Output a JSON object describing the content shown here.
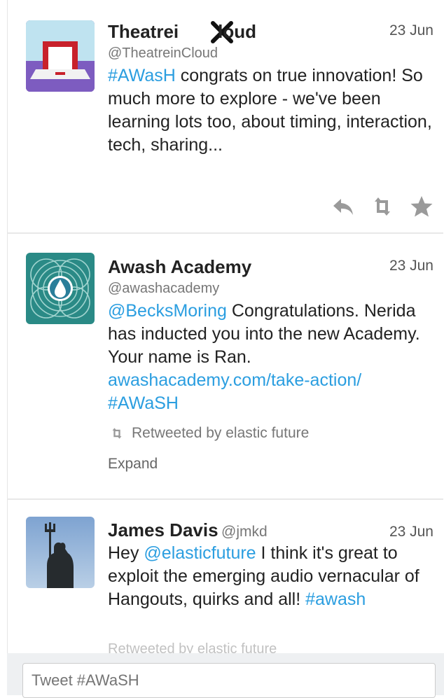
{
  "tweets": [
    {
      "name": "Theatrei",
      "name_tail": "loud",
      "handle": "@TheatreinCloud",
      "date": "23 Jun",
      "text_link": "#AWasH",
      "text_rest": " congrats on true innovation! So much more to explore - we've been learning lots too, about timing, interaction, tech, sharing..."
    },
    {
      "name": "Awash Academy",
      "handle": "@awashacademy",
      "date": "23 Jun",
      "mention": "@BecksMoring",
      "text_rest": " Congratulations. Nerida has inducted you into the new Academy. Your name is Ran.",
      "url": "awashacademy.com/take-action/",
      "hashtag": "#AWaSH",
      "retweeted_by": "Retweeted by elastic future",
      "expand": "Expand"
    },
    {
      "name": "James Davis",
      "handle": "@jmkd",
      "date": "23 Jun",
      "text_pre": "Hey ",
      "mention": "@elasticfuture",
      "text_rest": " I think it's great to exploit the emerging audio vernacular of Hangouts, quirks and all! ",
      "hashtag": "#awash",
      "retweeted_by": "Retweeted by elastic future"
    }
  ],
  "compose": {
    "placeholder": "Tweet #AWaSH"
  },
  "icons": {
    "reply": "reply-icon",
    "retweet": "retweet-icon",
    "favorite": "star-icon",
    "close": "close-icon"
  },
  "colors": {
    "link": "#2b9ee0",
    "text": "#222222",
    "muted": "#777777"
  }
}
